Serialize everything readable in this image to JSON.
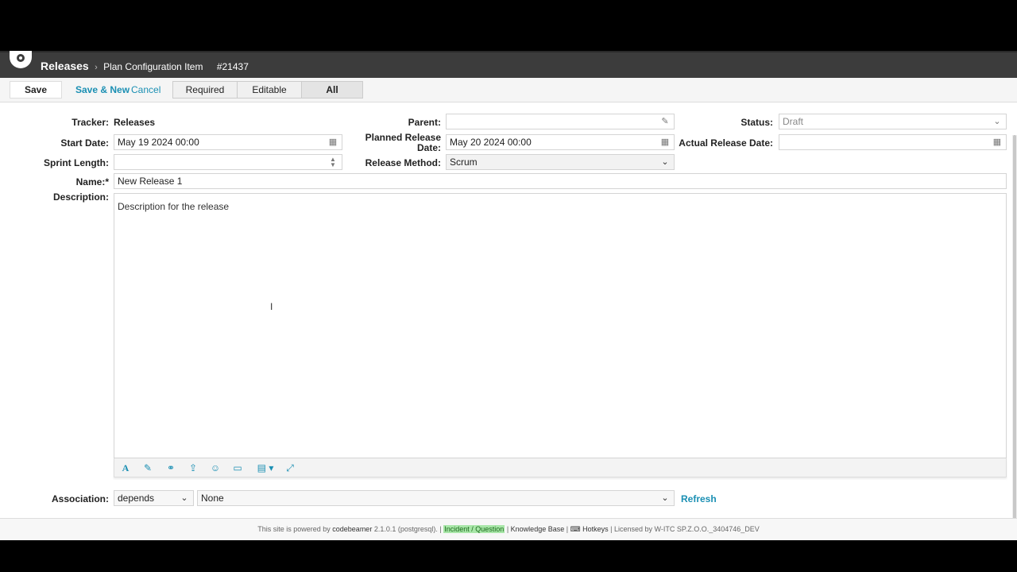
{
  "header": {
    "tracker": "Releases",
    "separator": "›",
    "page": "Plan Configuration Item",
    "item_id": "#21437"
  },
  "toolbar": {
    "save": "Save",
    "save_new": "Save & New",
    "cancel": "Cancel",
    "filters": [
      "Required",
      "Editable",
      "All"
    ],
    "active_filter": "All"
  },
  "form": {
    "tracker_label": "Tracker:",
    "tracker_value": "Releases",
    "parent_label": "Parent:",
    "parent_value": "",
    "status_label": "Status:",
    "status_value": "Draft",
    "start_date_label": "Start Date:",
    "start_date_value": "May 19 2024 00:00",
    "planned_release_label_1": "Planned Release",
    "planned_release_label_2": "Date:",
    "planned_release_value": "May 20 2024 00:00",
    "actual_release_label": "Actual Release Date:",
    "actual_release_value": "",
    "sprint_length_label": "Sprint Length:",
    "sprint_length_value": "",
    "release_method_label": "Release Method:",
    "release_method_value": "Scrum",
    "name_label": "Name:*",
    "name_value": "New Release 1",
    "description_label": "Description:",
    "description_value": "Description for the release"
  },
  "editor_toolbar_icons": [
    "font-icon",
    "edit-icon",
    "link-icon",
    "upload-icon",
    "emoji-icon",
    "screen-icon",
    "table-icon",
    "expand-icon"
  ],
  "association": {
    "label": "Association:",
    "type_value": "depends",
    "target_value": "None",
    "refresh": "Refresh"
  },
  "footer": {
    "powered_prefix": "This site is powered by",
    "product": "codebeamer",
    "version": "2.1.0.1 (postgresql). |",
    "incident": "Incident / Question",
    "sep1": "|",
    "kb": "Knowledge Base",
    "sep2": "|",
    "hotkeys": "Hotkeys",
    "licensed_prefix": "| Licensed by",
    "licensee": "W-ITC SP.Z.O.O._3404746_DEV"
  },
  "colors": {
    "link": "#1a8fb3",
    "header_bg": "#3c3c3c",
    "incident_bg": "#a8e6a8"
  }
}
